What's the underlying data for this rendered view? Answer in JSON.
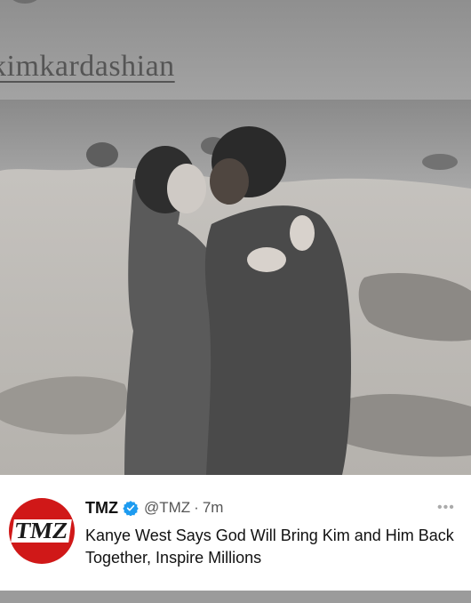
{
  "story": {
    "username": "kimkardashian",
    "photo_alt": "photo"
  },
  "tweet": {
    "avatar_text": "TMZ",
    "name": "TMZ",
    "handle": "@TMZ",
    "dot": "·",
    "time": "7m",
    "more": "•••",
    "text": "Kanye West Says God Will Bring Kim and Him Back Together, Inspire Millions"
  },
  "colors": {
    "avatar_bg": "#d01818",
    "verified": "#1d9bf0",
    "card_bg": "#ffffff"
  },
  "icons": [
    "verified-badge-icon",
    "more-options-icon"
  ]
}
